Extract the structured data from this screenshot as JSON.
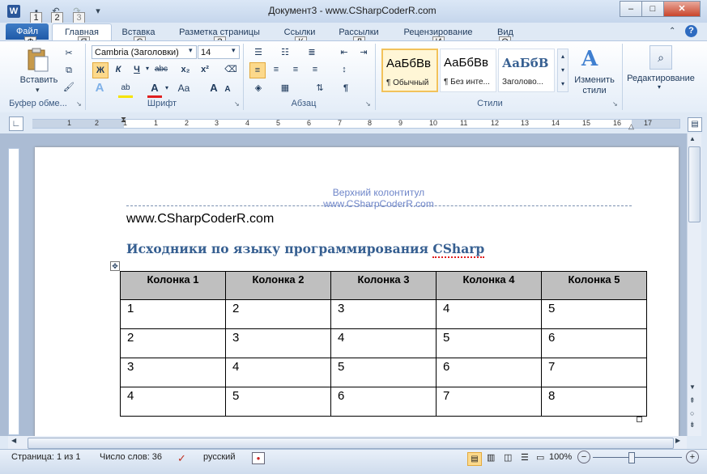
{
  "window": {
    "title": "Документ3 - www.CSharpCoderR.com",
    "app_icon": "W",
    "minimize": "–",
    "maximize": "□",
    "close": "✕"
  },
  "quick_access": {
    "keytips": [
      "1",
      "2",
      "3"
    ],
    "customize_icon": "▾"
  },
  "tabs": [
    {
      "label": "Файл",
      "keytip": "Ф"
    },
    {
      "label": "Главная",
      "keytip": "Я"
    },
    {
      "label": "Вставка",
      "keytip": "С"
    },
    {
      "label": "Разметка страницы",
      "keytip": "З"
    },
    {
      "label": "Ссылки",
      "keytip": "К"
    },
    {
      "label": "Рассылки",
      "keytip": "Л"
    },
    {
      "label": "Рецензирование",
      "keytip": "И"
    },
    {
      "label": "Вид",
      "keytip": "О"
    }
  ],
  "ribbon": {
    "clipboard": {
      "paste_label": "Вставить",
      "group_label": "Буфер обме..."
    },
    "font": {
      "font_name": "Cambria (Заголовки)",
      "font_size": "14",
      "bold": "Ж",
      "italic": "К",
      "underline": "Ч",
      "strike": "abc",
      "subscript": "x₂",
      "superscript": "x²",
      "grow": "A",
      "shrink": "A",
      "case": "Aa",
      "group_label": "Шрифт"
    },
    "paragraph": {
      "group_label": "Абзац",
      "pilcrow": "¶"
    },
    "styles": {
      "items": [
        {
          "preview": "АаБбВв",
          "name": "¶ Обычный"
        },
        {
          "preview": "АаБбВв",
          "name": "¶ Без инте..."
        },
        {
          "preview": "АаБбВ",
          "name": "Заголово..."
        }
      ],
      "change_styles_label": "Изменить стили",
      "group_label": "Стили"
    },
    "editing": {
      "label": "Редактирование"
    }
  },
  "ruler": {
    "numbers": [
      "1",
      "2",
      "1",
      "1",
      "2",
      "3",
      "4",
      "5",
      "6",
      "7",
      "8",
      "9",
      "10",
      "11",
      "12",
      "13",
      "14",
      "15",
      "16",
      "17"
    ]
  },
  "document": {
    "header_line1": "Верхний колонтитул",
    "header_line2": "www.CSharpCoderR.com",
    "site_text": "www.CSharpCoderR.com",
    "heading_prefix": "Исходники по языку программирования ",
    "heading_term": "CSharp",
    "table": {
      "headers": [
        "Колонка 1",
        "Колонка 2",
        "Колонка 3",
        "Колонка 4",
        "Колонка 5"
      ],
      "rows": [
        [
          "1",
          "2",
          "3",
          "4",
          "5"
        ],
        [
          "2",
          "3",
          "4",
          "5",
          "6"
        ],
        [
          "3",
          "4",
          "5",
          "6",
          "7"
        ],
        [
          "4",
          "5",
          "6",
          "7",
          "8"
        ]
      ]
    }
  },
  "status": {
    "page": "Страница: 1 из 1",
    "words": "Число слов: 36",
    "language": "русский",
    "zoom": "100%"
  }
}
